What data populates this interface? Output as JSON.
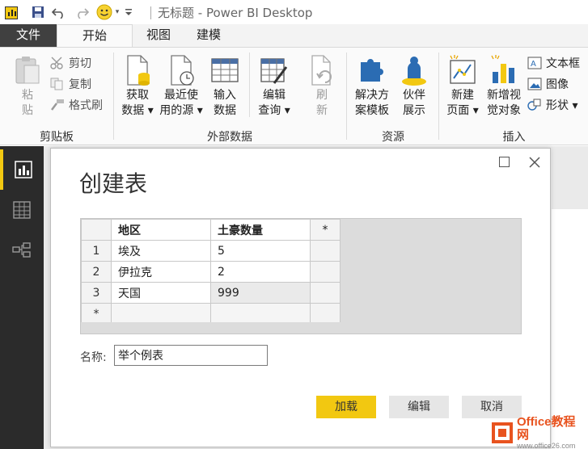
{
  "window": {
    "title": "无标题 - Power BI Desktop"
  },
  "tabs": [
    {
      "label": "文件"
    },
    {
      "label": "开始"
    },
    {
      "label": "视图"
    },
    {
      "label": "建模"
    }
  ],
  "ribbon": {
    "clipboard": {
      "label": "剪贴板",
      "paste": [
        "粘",
        "贴"
      ],
      "cut": "剪切",
      "copy": "复制",
      "format_painter": "格式刷"
    },
    "external_data": {
      "label": "外部数据",
      "get_data": [
        "获取",
        "数据 ▾"
      ],
      "recent_sources": [
        "最近使",
        "用的源 ▾"
      ],
      "enter_data": [
        "输入",
        "数据"
      ],
      "edit_queries": [
        "编辑",
        "查询 ▾"
      ],
      "refresh": [
        "刷",
        "新"
      ]
    },
    "resources": {
      "label": "资源",
      "solution_templates": [
        "解决方",
        "案模板"
      ],
      "partner_showcase": [
        "伙伴",
        "展示"
      ]
    },
    "insert": {
      "label": "插入",
      "new_page": [
        "新建",
        "页面 ▾"
      ],
      "new_visual": [
        "新增视",
        "觉对象"
      ],
      "text_box": "文本框",
      "image": "图像",
      "shapes": "形状 ▾"
    }
  },
  "dialog": {
    "title": "创建表",
    "columns": [
      "地区",
      "土豪数量"
    ],
    "add_column_marker": "*",
    "rows": [
      {
        "num": "1",
        "region": "埃及",
        "count": "5"
      },
      {
        "num": "2",
        "region": "伊拉克",
        "count": "2"
      },
      {
        "num": "3",
        "region": "天国",
        "count": "999"
      }
    ],
    "new_row_marker": "*",
    "name_label": "名称:",
    "name_value": "举个例表",
    "buttons": {
      "load": "加载",
      "edit": "编辑",
      "cancel": "取消"
    }
  },
  "watermark": {
    "line1": "Office教程网",
    "line2": "www.office26.com"
  },
  "colors": {
    "accent": "#f2c811",
    "nav_bg": "#2b2b2b",
    "file_tab": "#404040",
    "watermark": "#e8531f"
  }
}
